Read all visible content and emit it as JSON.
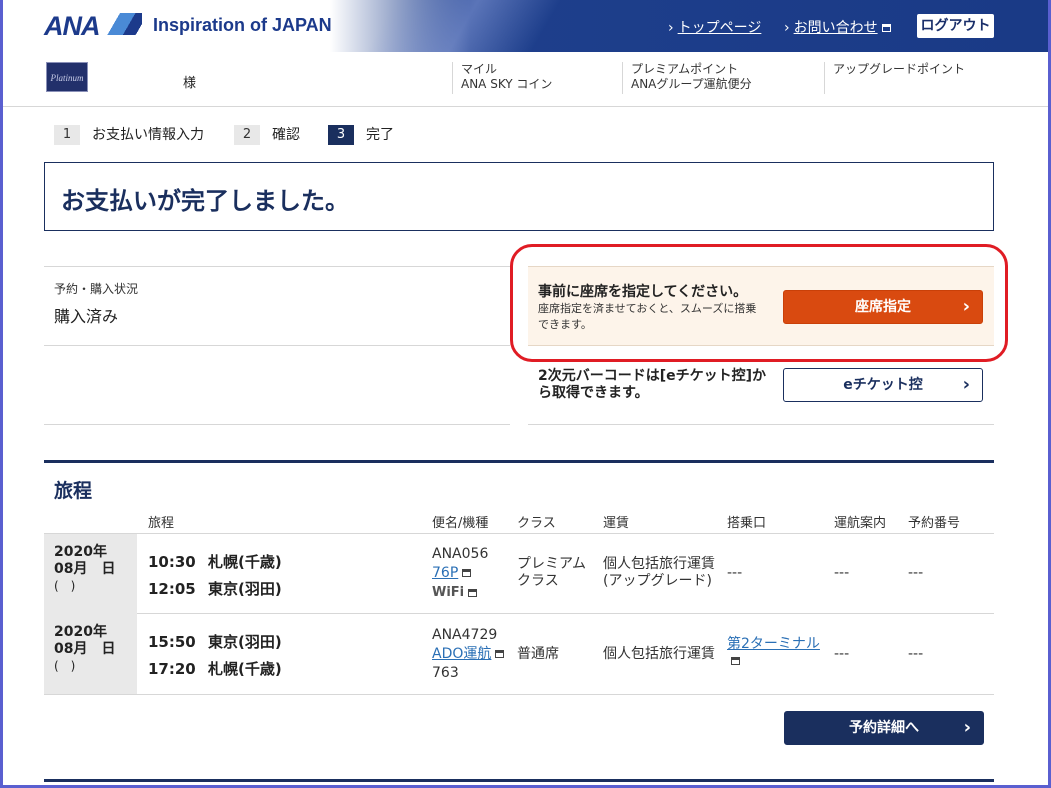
{
  "header": {
    "logo_text": "ANA",
    "tagline": "Inspiration of JAPAN",
    "top_page_link": "トップページ",
    "contact_link": "お問い合わせ",
    "logout_label": "ログアウト"
  },
  "member": {
    "card_text": "Platinum",
    "honorific": "様",
    "miles_label": "マイル",
    "skycoin_label": "ANA SKY コイン",
    "premium_label": "プレミアムポイント",
    "premium_sub": "ANAグループ運航便分",
    "upgrade_label": "アップグレードポイント"
  },
  "steps": [
    {
      "num": "1",
      "label": "お支払い情報入力"
    },
    {
      "num": "2",
      "label": "確認"
    },
    {
      "num": "3",
      "label": "完了"
    }
  ],
  "complete": {
    "title": "お支払いが完了しました。"
  },
  "status": {
    "label": "予約・購入状況",
    "value": "購入済み"
  },
  "seat": {
    "title": "事前に座席を指定してください。",
    "desc": "座席指定を済ませておくと、スムーズに搭乗できます。",
    "button": "座席指定"
  },
  "eticket": {
    "text": "2次元バーコードは[eチケット控]から取得できます。",
    "button": "eチケット控"
  },
  "itinerary": {
    "title": "旅程",
    "columns": {
      "route": "旅程",
      "flight": "便名/機種",
      "class": "クラス",
      "fare": "運賃",
      "gate": "搭乗口",
      "ops": "運航案内",
      "booking": "予約番号"
    },
    "rows": [
      {
        "year": "2020年",
        "month_day": "08月　日",
        "dow": "(　)",
        "dep_time": "10:30",
        "dep_place": "札幌(千歳)",
        "arr_time": "12:05",
        "arr_place": "東京(羽田)",
        "flight_no": "ANA056",
        "aircraft": "76P",
        "wifi": "WiFi",
        "class_line1": "プレミアム",
        "class_line2": "クラス",
        "fare_line1": "個人包括旅行運賃",
        "fare_line2": "(アップグレード)",
        "gate": "---",
        "ops": "---",
        "booking": "---"
      },
      {
        "year": "2020年",
        "month_day": "08月　日",
        "dow": "(　)",
        "dep_time": "15:50",
        "dep_place": "東京(羽田)",
        "arr_time": "17:20",
        "arr_place": "札幌(千歳)",
        "flight_no": "ANA4729",
        "aircraft": "ADO運航",
        "aircraft_type": "763",
        "class_line1": "普通席",
        "fare_line1": "個人包括旅行運賃",
        "gate": "第2ターミナル",
        "ops": "---",
        "booking": "---"
      }
    ]
  },
  "detail_button": "予約詳細へ",
  "colors": {
    "navy": "#1a2f5e",
    "orange": "#d94a10",
    "highlight_ring": "#e01c24"
  }
}
